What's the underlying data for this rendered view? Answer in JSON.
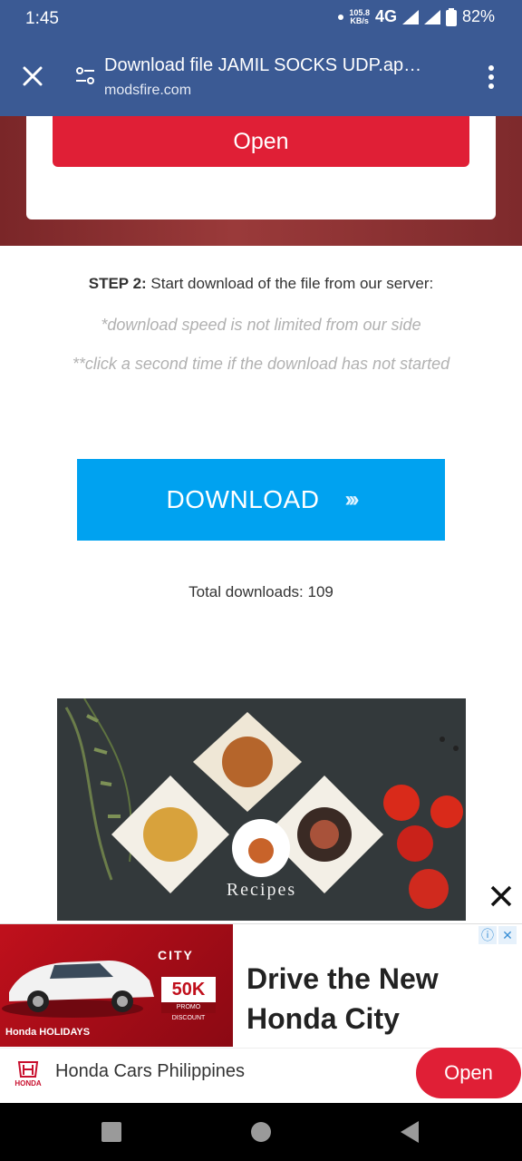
{
  "status_bar": {
    "time": "1:45",
    "net_speed_value": "105.8",
    "net_speed_unit": "KB/s",
    "network": "4G",
    "battery": "82%"
  },
  "app_bar": {
    "title": "Download file JAMIL SOCKS UDP.ap…",
    "domain": "modsfire.com",
    "close_icon": "close-icon",
    "more_icon": "more-vert-icon"
  },
  "hero": {
    "open_label": "Open"
  },
  "step": {
    "label": "STEP 2:",
    "text": " Start download of the file from our server:",
    "note1": "*download speed is not limited from our side",
    "note2": "**click a second time if the download has not started"
  },
  "download": {
    "label": "DOWNLOAD",
    "arrows": "›››",
    "total": "Total downloads: 109"
  },
  "recipes_image": {
    "caption": "Recipes"
  },
  "ad": {
    "image_city": "CITY",
    "image_badge": "50K",
    "image_promo": "PROMO DISCOUNT",
    "image_holidays": "Honda HOLIDAYS",
    "headline": "Drive the New Honda City",
    "advertiser": "Honda Cars Philippines",
    "open_label": "Open",
    "brand_mark": "HONDA",
    "choices_icon": "info-icon",
    "colors": {
      "accent": "#e01f36",
      "download": "#00a2f0",
      "appbar": "#3b5a94"
    }
  },
  "nav": {
    "recents_icon": "square-icon",
    "home_icon": "circle-icon",
    "back_icon": "triangle-back-icon"
  }
}
